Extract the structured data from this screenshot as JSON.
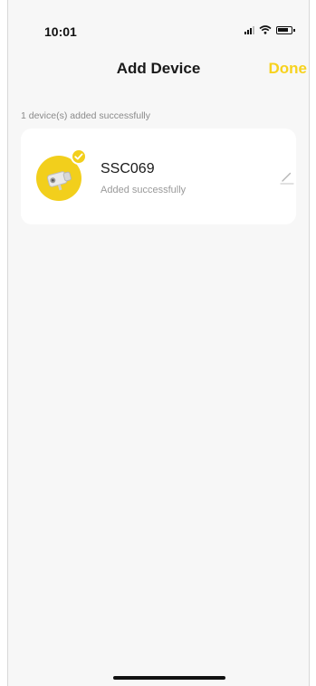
{
  "status_bar": {
    "time": "10:01"
  },
  "nav": {
    "title": "Add Device",
    "done_label": "Done"
  },
  "caption": "1 device(s) added successfully",
  "devices": [
    {
      "name": "SSC069",
      "status": "Added successfully",
      "icon": "camera-icon"
    }
  ],
  "colors": {
    "accent": "#f7d21e",
    "avatar_bg": "#f2cf1c",
    "caption_text": "#8a8a8a",
    "screen_bg": "#f7f7f7"
  }
}
